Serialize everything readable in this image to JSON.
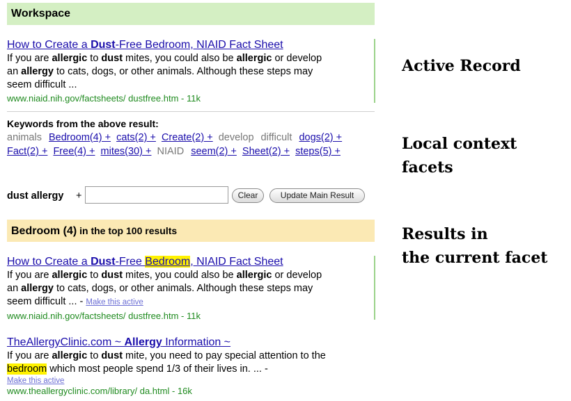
{
  "workspace": {
    "header": "Workspace"
  },
  "active_record": {
    "title_parts": [
      "How to Create a ",
      "Dust",
      "-Free Bedroom, NIAID Fact Sheet"
    ],
    "snippet_line1": [
      "If you are ",
      "allergic",
      " to ",
      "dust",
      " mites, you could also be ",
      "allergic",
      " or develop"
    ],
    "snippet_line2": [
      "an ",
      "allergy",
      " to cats, dogs, or other animals. Although these steps may"
    ],
    "snippet_line3": "seem difficult ...",
    "url": "www.niaid.nih.gov/factsheets/ dustfree.htm - 11k"
  },
  "keywords": {
    "heading": "Keywords from the above result:",
    "items": [
      {
        "text": "animals",
        "link": false
      },
      {
        "text": "Bedroom(4) +",
        "link": true
      },
      {
        "text": "cats(2) +",
        "link": true
      },
      {
        "text": "Create(2) +",
        "link": true
      },
      {
        "text": "develop",
        "link": false
      },
      {
        "text": "difficult",
        "link": false
      },
      {
        "text": "dogs(2) +",
        "link": true
      },
      {
        "text": "Fact(2) +",
        "link": true
      },
      {
        "text": "Free(4) +",
        "link": true
      },
      {
        "text": "mites(30) +",
        "link": true
      },
      {
        "text": "NIAID",
        "link": false
      },
      {
        "text": "seem(2) +",
        "link": true
      },
      {
        "text": "Sheet(2) +",
        "link": true
      },
      {
        "text": "steps(5) +",
        "link": true
      }
    ]
  },
  "query": {
    "label": "dust allergy",
    "plus": "+",
    "value": "",
    "clear_label": "Clear",
    "update_label": "Update Main Result"
  },
  "facet": {
    "name": "Bedroom (4)",
    "suffix": " in the top 100 results"
  },
  "results": [
    {
      "title_parts": [
        "How to Create a ",
        "Dust",
        "-Free ",
        "Bedroom",
        ", NIAID Fact Sheet"
      ],
      "snippet_line1": [
        "If you are ",
        "allergic",
        " to ",
        "dust",
        " mites, you could also be ",
        "allergic",
        " or develop"
      ],
      "snippet_line2": [
        "an ",
        "allergy",
        " to cats, dogs, or other animals. Although these steps may"
      ],
      "snippet_line3": "seem difficult ... - ",
      "make_active": "Make this active",
      "url": "www.niaid.nih.gov/factsheets/ dustfree.htm - 11k"
    },
    {
      "title_parts": [
        "TheAllergyClinic.com ~ ",
        "Allergy",
        " Information ~"
      ],
      "snippet_line1": [
        "If you are ",
        "allergic",
        " to ",
        "dust",
        " mite, you need to pay special attention to the"
      ],
      "snippet_line2": [
        "bedroom",
        " which most people spend 1/3 of their lives in. ... -"
      ],
      "make_active": "Make this active",
      "url": "www.theallergyclinic.com/library/ da.html - 16k"
    }
  ],
  "side_labels": {
    "active_record": "Active Record",
    "local_facets": "Local context facets",
    "results_line1": "Results in",
    "results_line2": "the current facet"
  },
  "colors": {
    "workspace_header_bg": "#d4efc3",
    "facet_header_bg": "#fbe9b4",
    "link": "#1a0dab",
    "url_green": "#1e8a1e",
    "highlight": "#fff200"
  }
}
